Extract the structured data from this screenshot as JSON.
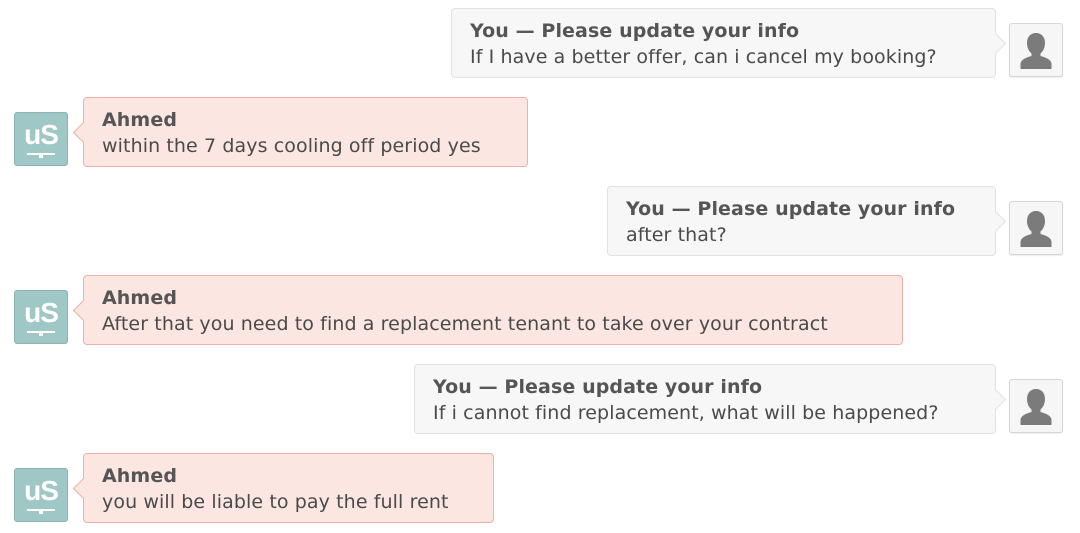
{
  "messages": [
    {
      "sender": "user",
      "name": "You — Please update your info",
      "text": "If I have a better offer, can i cancel my booking?"
    },
    {
      "sender": "agent",
      "name": "Ahmed",
      "text": "within the 7 days cooling off period yes"
    },
    {
      "sender": "user",
      "name": "You — Please update your info",
      "text": "after that?"
    },
    {
      "sender": "agent",
      "name": "Ahmed",
      "text": "After that you need to find a replacement tenant to take over your contract"
    },
    {
      "sender": "user",
      "name": "You — Please update your info",
      "text": "If i cannot find replacement, what will be happened?"
    },
    {
      "sender": "agent",
      "name": "Ahmed",
      "text": "you will be liable to pay the full rent"
    }
  ],
  "agent_avatar": {
    "logo_text": "uS",
    "icon": "uniplaces-logo-icon",
    "color": "#9fc7c6"
  },
  "user_avatar": {
    "icon": "default-user-silhouette-icon"
  },
  "colors": {
    "user_bubble": "#f7f7f7",
    "agent_bubble": "#fbe6e2",
    "agent_border": "#edb1a6"
  }
}
